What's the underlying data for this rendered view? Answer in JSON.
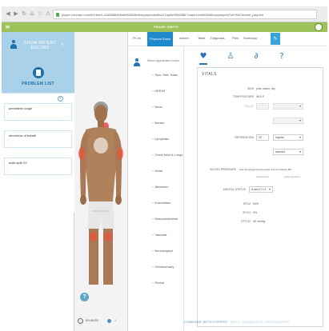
{
  "browser": {
    "url": "player.i-human.com/#/f1b0c9-41d58884e6a96f1f2b8e4ce/play/ndtwBs471ep8e90fd2f8b7/case1/eb5b95d5oqu/play/ed7cb7f0b7a/ebel_play.ent",
    "nav_icons": [
      "back-arrow",
      "forward-arrow",
      "reload",
      "home",
      "star",
      "shield"
    ]
  },
  "app": {
    "patient_name": "FRANK SMITH",
    "colors": {
      "header": "#9dc25a",
      "panel": "#a9d1e9",
      "accent": "#1f8acb"
    }
  },
  "left": {
    "show_record_label": "SHOW PATIENT RECORD",
    "problem_list_title": "PROBLEM LIST",
    "problems": [
      {
        "text": "persistent cough"
      },
      {
        "text": "shortness of breath"
      },
      {
        "text": "wide-split S2"
      }
    ]
  },
  "timer": {
    "time": "00:49:25"
  },
  "tabs": [
    {
      "label": "Pt. hx",
      "active": false
    },
    {
      "label": "Physical Exam",
      "active": true
    },
    {
      "label": "Assm't",
      "active": false
    },
    {
      "label": "Tests",
      "active": false
    },
    {
      "label": "Diagnosis",
      "active": false
    },
    {
      "label": "Plan",
      "active": false
    },
    {
      "label": "Summary",
      "active": false
    }
  ],
  "exam": {
    "instruction": "Select appropriate exams",
    "items": [
      "Skin, Hair, Nails",
      "HEENT",
      "Neck",
      "Breast",
      "Lymphatic",
      "Chest Wall & Lungs",
      "Heart",
      "Abdomen",
      "Extremities",
      "Musculoskeletal",
      "Vascular",
      "Neurological",
      "Genitourinary",
      "Rectal"
    ]
  },
  "icon_row": [
    "heart-icon",
    "person-icon",
    "ear-icon",
    "question-icon"
  ],
  "vitals": {
    "title": "VITALS",
    "skin_label": "SKIN",
    "skin_value": "pink, warm, dry",
    "temp_label": "TEMPERATURE",
    "temp_value": "98.8 F",
    "pulse_label": "PULSE",
    "resp_label": "RESPIRATION",
    "resp_value": "22",
    "resp_rhythm": "regular",
    "resp_effort": "labored",
    "bp_label": "BLOOD PRESSURE",
    "bp_note": "Use the sphygmomanometer tool to measure BP",
    "bp_assessment": "assessment",
    "bp_pulse_pressure": "pulse pressure",
    "mental_label": "MENTAL STATUS",
    "mental_value": "A and O x 4",
    "spo2_label": "SPO2",
    "spo2_value": "94%",
    "spco_label": "SPCO",
    "spco_value": "3%",
    "etco2_label": "ETCO2",
    "etco2_value": "40 mmHg"
  },
  "footer": {
    "compare": "COMPARE WITH EXPERT",
    "next": "NEXT: DIAGNOSTIC ASSESSMENT"
  }
}
